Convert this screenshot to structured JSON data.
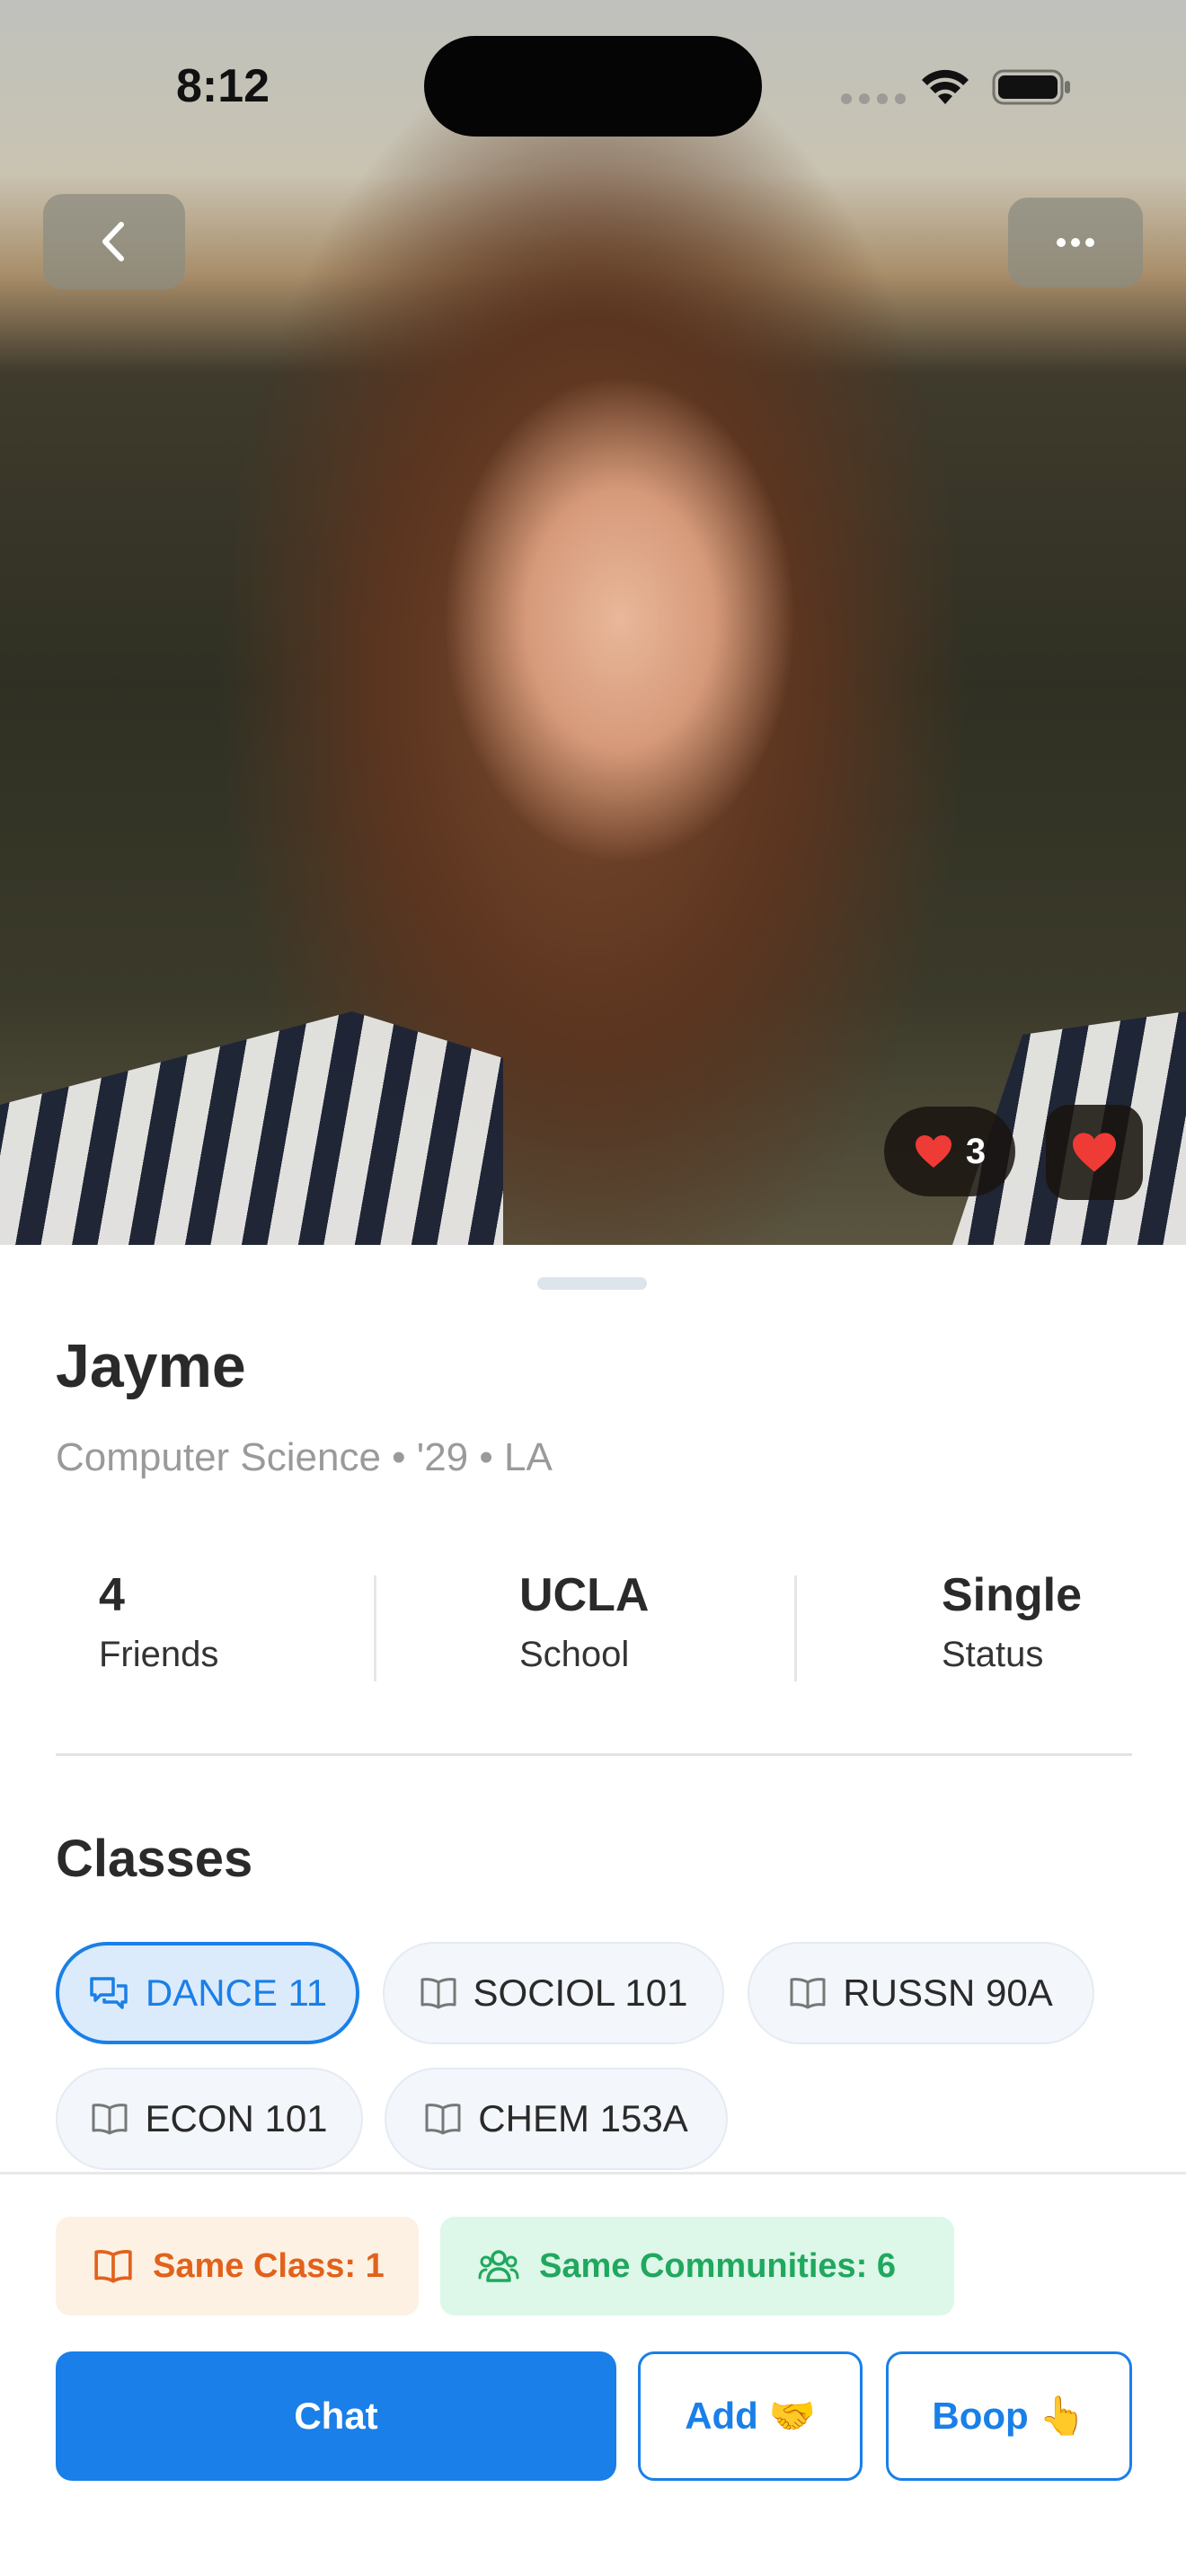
{
  "status_bar": {
    "time": "8:12"
  },
  "icons": {
    "back": "chevron-left-icon",
    "more": "ellipsis-icon",
    "like": "heart-icon",
    "class_active": "chat-bubbles-icon",
    "class": "book-icon",
    "community": "people-icon"
  },
  "colors": {
    "accent": "#1a7fe8",
    "heart": "#ef3b36",
    "orange": "#e2621b",
    "green": "#20a85e"
  },
  "hero": {
    "likes_count": "3"
  },
  "profile": {
    "name": "Jayme",
    "subline": "Computer Science • '29 • LA",
    "stats": [
      {
        "value": "4",
        "label": "Friends"
      },
      {
        "value": "UCLA",
        "label": "School"
      },
      {
        "value": "Single",
        "label": "Status"
      }
    ]
  },
  "classes": {
    "title": "Classes",
    "items": [
      "DANCE 11",
      "SOCIOL 101",
      "RUSSN 90A",
      "ECON 101",
      "CHEM 153A"
    ],
    "active_index": 0
  },
  "badges": {
    "same_class": "Same Class: 1",
    "same_communities": "Same Communities: 6"
  },
  "actions": {
    "chat": "Chat",
    "add": "Add 🤝",
    "boop": "Boop 👆"
  }
}
